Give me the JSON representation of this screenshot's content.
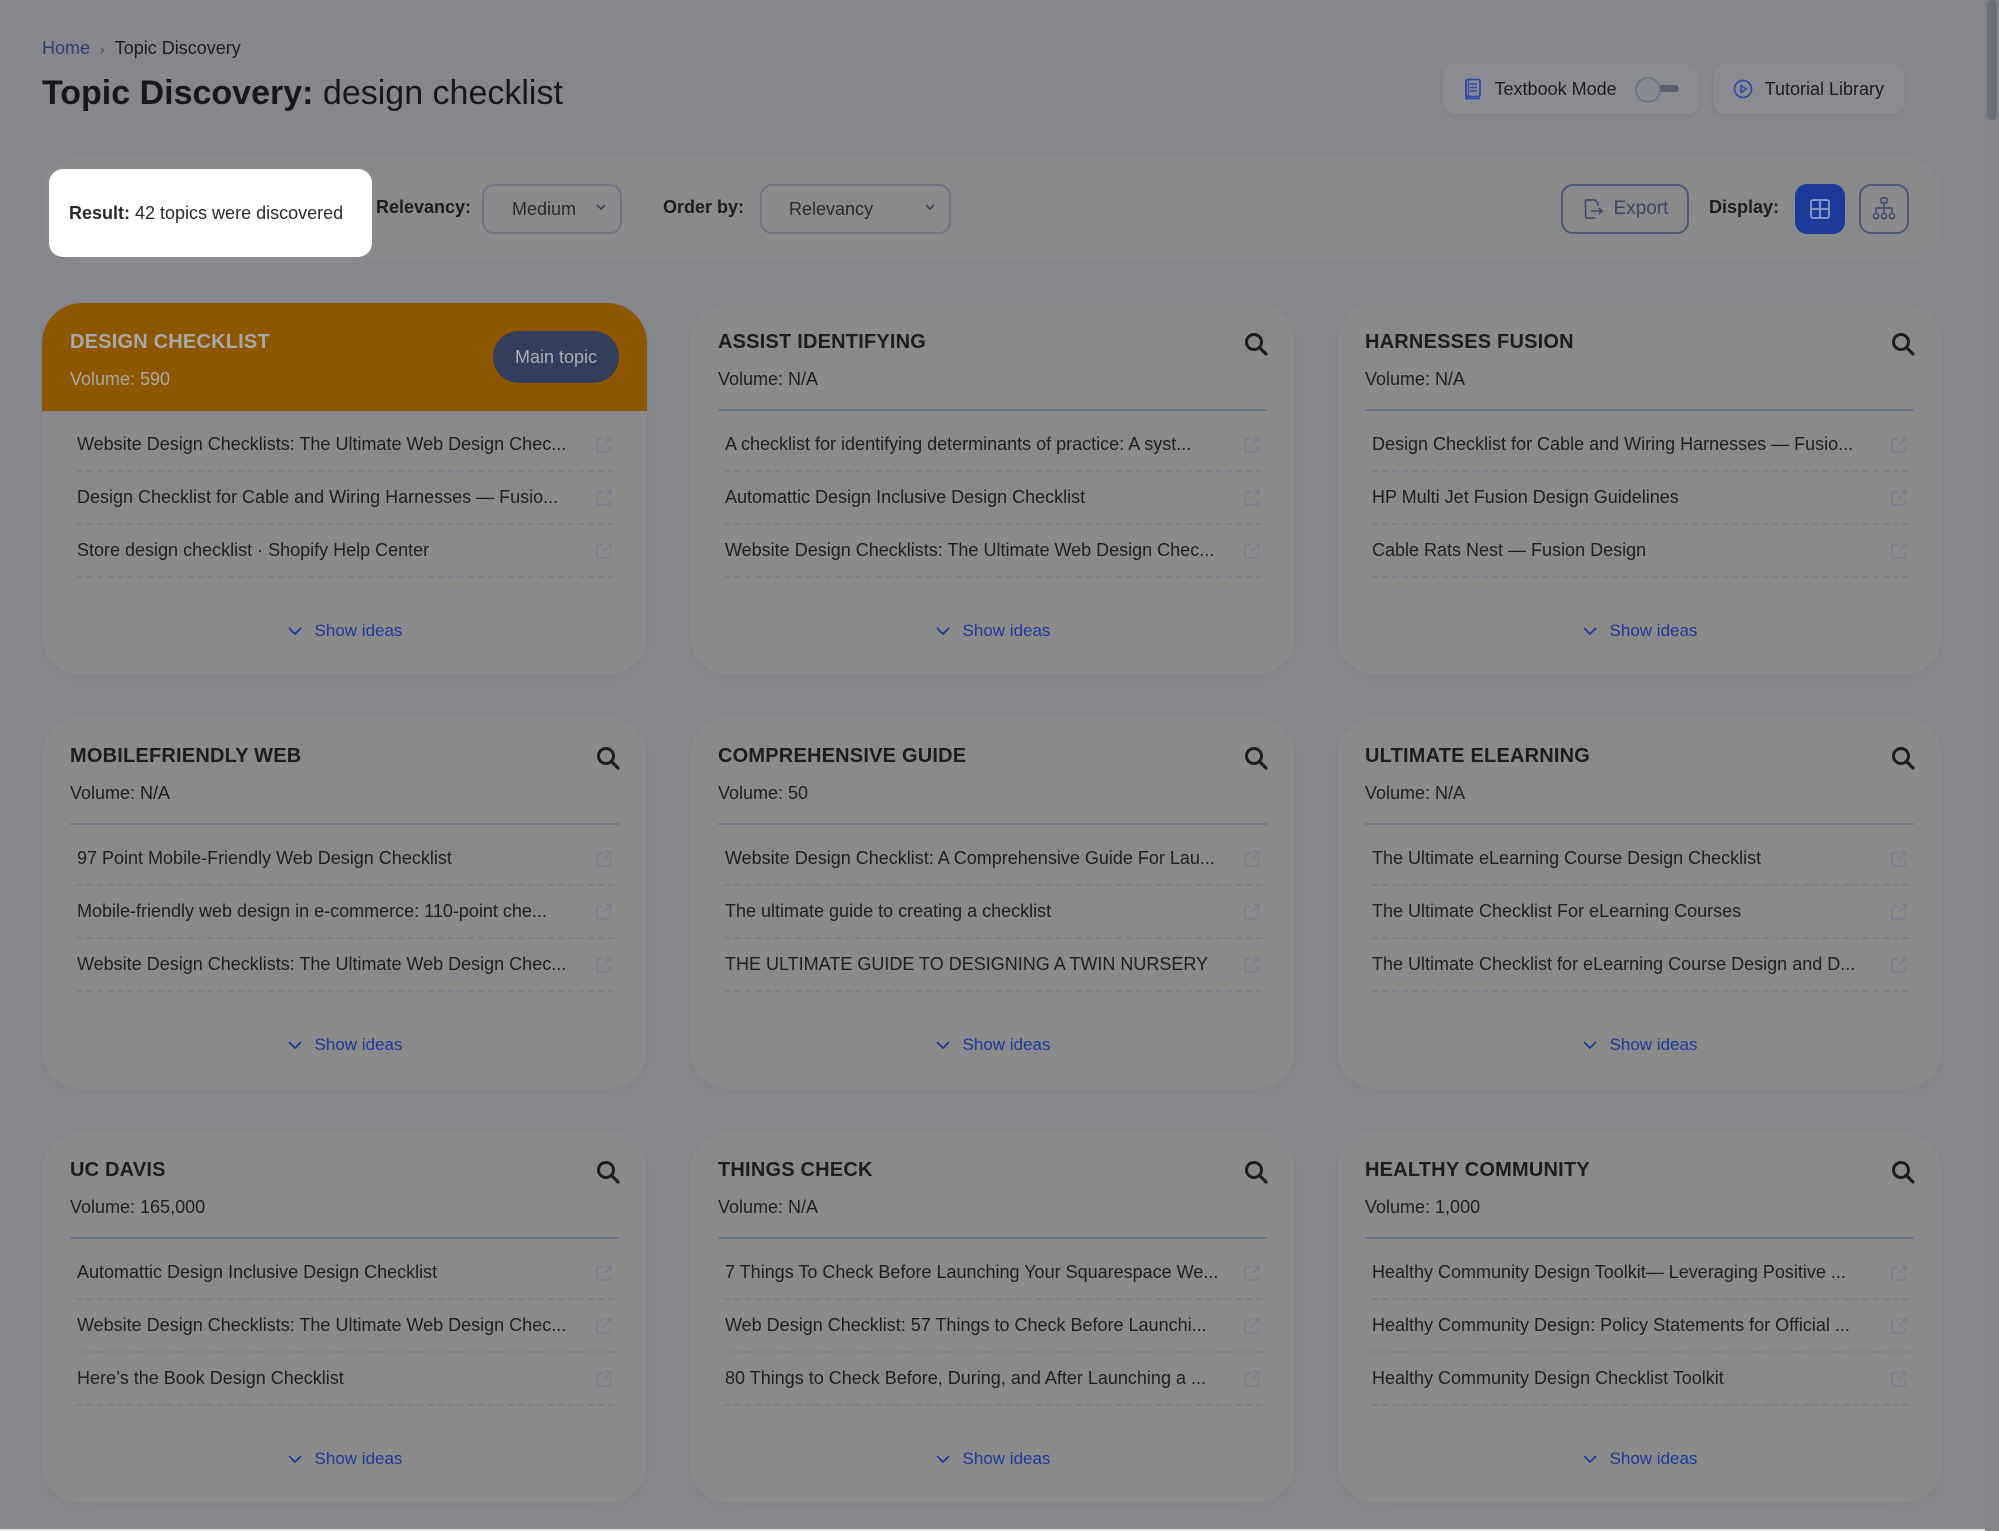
{
  "breadcrumb": {
    "home": "Home",
    "separator": "›",
    "current": "Topic Discovery"
  },
  "header": {
    "title_bold": "Topic Discovery:",
    "title_query": "design checklist"
  },
  "actions": {
    "textbook_mode": "Textbook Mode",
    "textbook_mode_on": false,
    "tutorial_library": "Tutorial Library"
  },
  "filters": {
    "result_label": "Result:",
    "result_text": "42 topics were discovered",
    "relevancy_label": "Relevancy:",
    "relevancy_value": "Medium",
    "order_label": "Order by:",
    "order_value": "Relevancy",
    "export_label": "Export",
    "display_label": "Display:",
    "active_display": "grid"
  },
  "colors": {
    "main_topic": "#8d5600",
    "accent": "#1d3a9a",
    "badge": "#323e5b"
  },
  "cards": [
    {
      "title": "DESIGN CHECKLIST",
      "volume": "Volume: 590",
      "main": true,
      "badge": "Main topic",
      "links": [
        "Website Design Checklists: The Ultimate Web Design Chec...",
        "Design Checklist for Cable and Wiring Harnesses — Fusio...",
        "Store design checklist · Shopify Help Center"
      ],
      "show_ideas": "Show ideas"
    },
    {
      "title": "ASSIST IDENTIFYING",
      "volume": "Volume: N/A",
      "main": false,
      "links": [
        "A checklist for identifying determinants of practice: A syst...",
        "Automattic Design Inclusive Design Checklist",
        "Website Design Checklists: The Ultimate Web Design Chec..."
      ],
      "show_ideas": "Show ideas"
    },
    {
      "title": "HARNESSES FUSION",
      "volume": "Volume: N/A",
      "main": false,
      "links": [
        "Design Checklist for Cable and Wiring Harnesses — Fusio...",
        "HP Multi Jet Fusion Design Guidelines",
        "Cable Rats Nest — Fusion Design"
      ],
      "show_ideas": "Show ideas"
    },
    {
      "title": "MOBILEFRIENDLY WEB",
      "volume": "Volume: N/A",
      "main": false,
      "links": [
        "97 Point Mobile-Friendly Web Design Checklist",
        "Mobile-friendly web design in e-commerce: 110-point che...",
        "Website Design Checklists: The Ultimate Web Design Chec..."
      ],
      "show_ideas": "Show ideas"
    },
    {
      "title": "COMPREHENSIVE GUIDE",
      "volume": "Volume: 50",
      "main": false,
      "links": [
        "Website Design Checklist: A Comprehensive Guide For Lau...",
        "The ultimate guide to creating a checklist",
        "THE ULTIMATE GUIDE TO DESIGNING A TWIN NURSERY"
      ],
      "show_ideas": "Show ideas"
    },
    {
      "title": "ULTIMATE ELEARNING",
      "volume": "Volume: N/A",
      "main": false,
      "links": [
        "The Ultimate eLearning Course Design Checklist",
        "The Ultimate Checklist For eLearning Courses",
        "The Ultimate Checklist for eLearning Course Design and D..."
      ],
      "show_ideas": "Show ideas"
    },
    {
      "title": "UC DAVIS",
      "volume": "Volume: 165,000",
      "main": false,
      "links": [
        "Automattic Design Inclusive Design Checklist",
        "Website Design Checklists: The Ultimate Web Design Chec...",
        "Here’s the Book Design Checklist"
      ],
      "show_ideas": "Show ideas"
    },
    {
      "title": "THINGS CHECK",
      "volume": "Volume: N/A",
      "main": false,
      "links": [
        "7 Things To Check Before Launching Your Squarespace We...",
        "Web Design Checklist: 57 Things to Check Before Launchi...",
        "80 Things to Check Before, During, and After Launching a ..."
      ],
      "show_ideas": "Show ideas"
    },
    {
      "title": "HEALTHY COMMUNITY",
      "volume": "Volume: 1,000",
      "main": false,
      "links": [
        "Healthy Community Design Toolkit— Leveraging Positive ...",
        "Healthy Community Design: Policy Statements for Official ...",
        "Healthy Community Design Checklist Toolkit"
      ],
      "show_ideas": "Show ideas"
    }
  ]
}
